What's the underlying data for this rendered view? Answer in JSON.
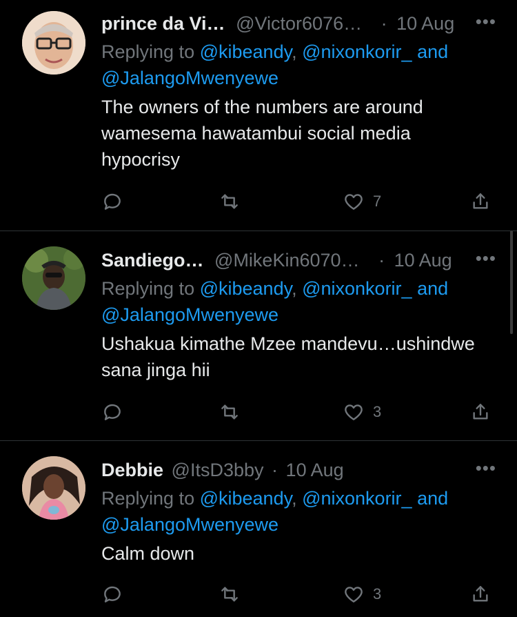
{
  "tweets": [
    {
      "name": "prince da Vi…",
      "handle": "@Victor6076…",
      "sep": "·",
      "time": "10 Aug",
      "more": "•••",
      "replying_prefix": "Replying to ",
      "mention1": "@kibeandy",
      "comma": ", ",
      "mention2": "@nixonkorir_",
      "and": " and",
      "mention3": "@JalangoMwenyewe",
      "text": "The owners of the numbers are around\nwamesema hawatambui social media\nhypocrisy",
      "likes": "7"
    },
    {
      "name": "Sandiego…",
      "handle": "@MikeKin6070…",
      "sep": "·",
      "time": "10 Aug",
      "more": "•••",
      "replying_prefix": "Replying to ",
      "mention1": "@kibeandy",
      "comma": ", ",
      "mention2": "@nixonkorir_",
      "and": " and",
      "mention3": "@JalangoMwenyewe",
      "text": "Ushakua kimathe Mzee mandevu…ushindwe\nsana jinga hii",
      "likes": "3"
    },
    {
      "name": "Debbie",
      "handle": "@ItsD3bby",
      "sep": "·",
      "time": "10 Aug",
      "more": "•••",
      "replying_prefix": "Replying to ",
      "mention1": "@kibeandy",
      "comma": ", ",
      "mention2": "@nixonkorir_",
      "and": " and",
      "mention3": "@JalangoMwenyewe",
      "text": "Calm down",
      "likes": "3"
    }
  ],
  "icons": {
    "reply": "reply-icon",
    "retweet": "retweet-icon",
    "like": "heart-icon",
    "share": "share-icon"
  },
  "colors": {
    "background": "#000000",
    "link": "#1d9bf0",
    "muted": "#71767b",
    "text": "#e7e9ea",
    "divider": "#2f3336"
  }
}
